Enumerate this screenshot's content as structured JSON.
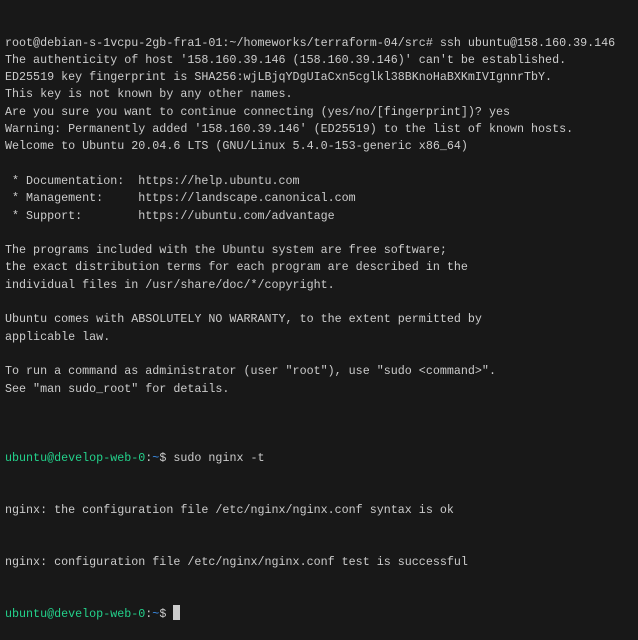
{
  "terminal": {
    "lines": [
      "root@debian-s-1vcpu-2gb-fra1-01:~/homeworks/terraform-04/src# ssh ubuntu@158.160.39.146",
      "The authenticity of host '158.160.39.146 (158.160.39.146)' can't be established.",
      "ED25519 key fingerprint is SHA256:wjLBjqYDgUIaCxn5cglkl38BKnoHaBXKmIVIgnnrTbY.",
      "This key is not known by any other names.",
      "Are you sure you want to continue connecting (yes/no/[fingerprint])? yes",
      "Warning: Permanently added '158.160.39.146' (ED25519) to the list of known hosts.",
      "Welcome to Ubuntu 20.04.6 LTS (GNU/Linux 5.4.0-153-generic x86_64)",
      "",
      " * Documentation:  https://help.ubuntu.com",
      " * Management:     https://landscape.canonical.com",
      " * Support:        https://ubuntu.com/advantage",
      "",
      "The programs included with the Ubuntu system are free software;",
      "the exact distribution terms for each program are described in the",
      "individual files in /usr/share/doc/*/copyright.",
      "",
      "Ubuntu comes with ABSOLUTELY NO WARRANTY, to the extent permitted by",
      "applicable law.",
      "",
      "To run a command as administrator (user \"root\"), use \"sudo <command>\".",
      "See \"man sudo_root\" for details.",
      ""
    ],
    "prompt1": {
      "user_host": "ubuntu@develop-web-0",
      "sep": ":",
      "path": "~",
      "symbol": "$ ",
      "command": "sudo nginx -t"
    },
    "output": [
      "nginx: the configuration file /etc/nginx/nginx.conf syntax is ok",
      "nginx: configuration file /etc/nginx/nginx.conf test is successful"
    ],
    "prompt2": {
      "user_host": "ubuntu@develop-web-0",
      "sep": ":",
      "path": "~",
      "symbol": "$ "
    },
    "colors": {
      "background": "#181818",
      "text": "#cccccc",
      "user": "#23d18b",
      "path": "#3b8eea"
    }
  }
}
